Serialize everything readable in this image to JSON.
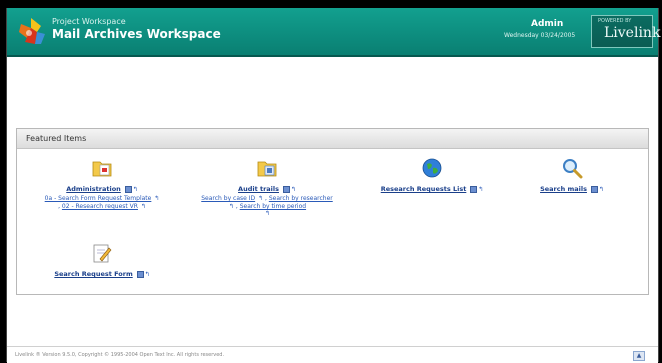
{
  "header": {
    "subtitle": "Project Workspace",
    "title": "Mail Archives Workspace",
    "user_name": "Admin",
    "user_date": "Wednesday 03/24/2005",
    "brand_small": "POWERED BY",
    "brand_name": "Livelink"
  },
  "panel": {
    "title": "Featured Items"
  },
  "items": [
    {
      "title": "Administration",
      "links": [
        "0a - Search Form Request Template",
        "02 - Research request VR"
      ],
      "icon": "folder-document-icon"
    },
    {
      "title": "Audit trails",
      "links": [
        "Search by case ID",
        "Search by researcher",
        "Search by time period"
      ],
      "icon": "folder-audit-icon"
    },
    {
      "title": "Research Requests List",
      "links": [],
      "icon": "globe-icon"
    },
    {
      "title": "Search mails",
      "links": [],
      "icon": "magnifier-icon"
    },
    {
      "title": "Search Request Form",
      "links": [],
      "icon": "pencil-form-icon"
    }
  ],
  "footer": {
    "text": "Livelink ® Version 9.5.0, Copyright © 1995-2004 Open Text Inc. All rights reserved."
  }
}
